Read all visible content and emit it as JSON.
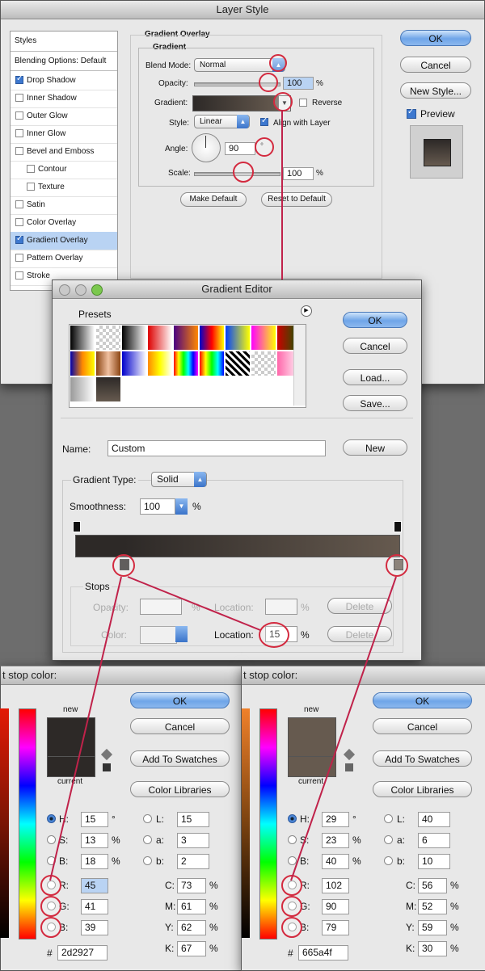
{
  "layer_style": {
    "title": "Layer Style",
    "styles_header": "Styles",
    "blending_options": "Blending Options: Default",
    "items": [
      {
        "label": "Drop Shadow",
        "checked": true
      },
      {
        "label": "Inner Shadow",
        "checked": false
      },
      {
        "label": "Outer Glow",
        "checked": false
      },
      {
        "label": "Inner Glow",
        "checked": false
      },
      {
        "label": "Bevel and Emboss",
        "checked": false
      },
      {
        "label": "Contour",
        "checked": false
      },
      {
        "label": "Texture",
        "checked": false
      },
      {
        "label": "Satin",
        "checked": false
      },
      {
        "label": "Color Overlay",
        "checked": false
      },
      {
        "label": "Gradient Overlay",
        "checked": true,
        "selected": true
      },
      {
        "label": "Pattern Overlay",
        "checked": false
      },
      {
        "label": "Stroke",
        "checked": false
      }
    ],
    "group_title": "Gradient Overlay",
    "subgroup_title": "Gradient",
    "blend_mode_label": "Blend Mode:",
    "blend_mode_value": "Normal",
    "opacity_label": "Opacity:",
    "opacity_value": "100",
    "percent": "%",
    "gradient_label": "Gradient:",
    "reverse_label": "Reverse",
    "style_label": "Style:",
    "style_value": "Linear",
    "align_label": "Align with Layer",
    "angle_label": "Angle:",
    "angle_value": "90",
    "degree": "°",
    "scale_label": "Scale:",
    "scale_value": "100",
    "make_default": "Make Default",
    "reset_default": "Reset to Default",
    "ok": "OK",
    "cancel": "Cancel",
    "new_style": "New Style...",
    "preview_label": "Preview"
  },
  "gradient_editor": {
    "title": "Gradient Editor",
    "presets_label": "Presets",
    "ok": "OK",
    "cancel": "Cancel",
    "load": "Load...",
    "save": "Save...",
    "name_label": "Name:",
    "name_value": "Custom",
    "new_button": "New",
    "gradient_type_label": "Gradient Type:",
    "gradient_type_value": "Solid",
    "smoothness_label": "Smoothness:",
    "smoothness_value": "100",
    "percent": "%",
    "stops_label": "Stops",
    "opacity_label": "Opacity:",
    "location_label": "Location:",
    "color_label": "Color:",
    "color_location_value": "15",
    "delete": "Delete"
  },
  "color_picker_left": {
    "title": "t stop color:",
    "ok": "OK",
    "cancel": "Cancel",
    "add_swatches": "Add To Swatches",
    "color_libraries": "Color Libraries",
    "new_label": "new",
    "current_label": "current",
    "new_color": "#2d2927",
    "H": "15",
    "S": "13",
    "Bv": "18",
    "R": "45",
    "G": "41",
    "B": "39",
    "L": "15",
    "a": "3",
    "b": "2",
    "C": "73",
    "M": "61",
    "Y": "62",
    "K": "67",
    "hex": "2d2927"
  },
  "color_picker_right": {
    "title": "t stop color:",
    "ok": "OK",
    "cancel": "Cancel",
    "add_swatches": "Add To Swatches",
    "color_libraries": "Color Libraries",
    "new_label": "new",
    "current_label": "current",
    "new_color": "#665a4f",
    "H": "29",
    "S": "23",
    "Bv": "40",
    "R": "102",
    "G": "90",
    "B": "79",
    "L": "40",
    "a": "6",
    "b": "10",
    "C": "56",
    "M": "52",
    "Y": "59",
    "K": "30",
    "hex": "665a4f"
  },
  "labels": {
    "h": "H:",
    "s": "S:",
    "b": "B:",
    "r": "R:",
    "g": "G:",
    "bb": "B:",
    "l": "L:",
    "a": "a:",
    "lb": "b:",
    "c": "C:",
    "m": "M:",
    "y": "Y:",
    "k": "K:",
    "deg": "°",
    "pct": "%",
    "hash": "#"
  },
  "colors": {
    "accent_red": "#d32a3f",
    "selection_blue": "#b9d3f3",
    "gradient_start": "#2d2927",
    "gradient_end": "#665a4f"
  }
}
